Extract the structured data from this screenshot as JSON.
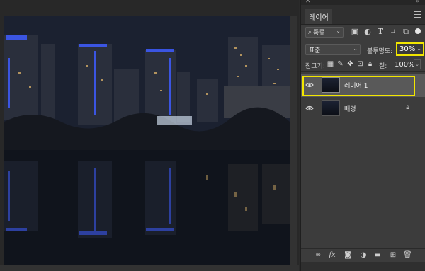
{
  "panel": {
    "tab_label": "레이어",
    "filter": {
      "kind_label": "종류",
      "icons": [
        "image-filter-icon",
        "adjustment-filter-icon",
        "type-filter-icon",
        "shape-filter-icon",
        "smart-object-filter-icon"
      ]
    },
    "blend_mode": "표준",
    "opacity_label": "불투명도:",
    "opacity_value": "30%",
    "lock_label": "잠그기:",
    "fill_label": "칠:",
    "fill_value": "100%"
  },
  "layers": [
    {
      "name": "레이어 1",
      "visible": true,
      "selected": true
    },
    {
      "name": "배경",
      "visible": true,
      "locked": true
    }
  ],
  "bottom_icons": [
    "link-icon",
    "fx-icon",
    "mask-icon",
    "adjustment-icon",
    "group-icon",
    "new-layer-icon",
    "trash-icon"
  ],
  "bottom_labels": {
    "fx": "fx"
  },
  "colors": {
    "highlight": "#f2e600",
    "panel_bg": "#3c3c3c",
    "selected_row": "#595959"
  }
}
